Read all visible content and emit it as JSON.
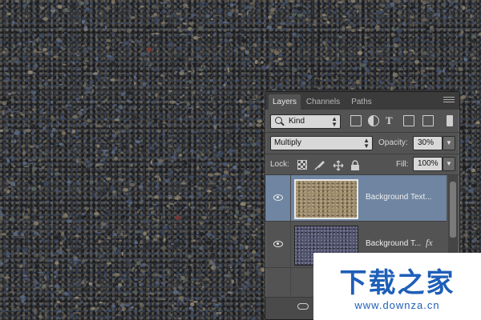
{
  "panel": {
    "tabs": [
      {
        "label": "Layers",
        "active": true
      },
      {
        "label": "Channels",
        "active": false
      },
      {
        "label": "Paths",
        "active": false
      }
    ],
    "filter": {
      "kind_label": "Kind"
    },
    "blend_mode": "Multiply",
    "opacity": {
      "label": "Opacity:",
      "value": "30%"
    },
    "lock": {
      "label": "Lock:"
    },
    "fill": {
      "label": "Fill:",
      "value": "100%"
    },
    "layers": [
      {
        "name": "Background Text...",
        "selected": true,
        "visible": true,
        "has_fx": false
      },
      {
        "name": "Background T...",
        "selected": false,
        "visible": true,
        "has_fx": true,
        "fx_label": "fx"
      }
    ]
  },
  "watermark": {
    "title": "下载之家",
    "url": "www.downza.cn"
  },
  "colors": {
    "selection": "#6f85a1",
    "panel_bg": "#535353",
    "watermark_blue": "#1e5fb8"
  }
}
